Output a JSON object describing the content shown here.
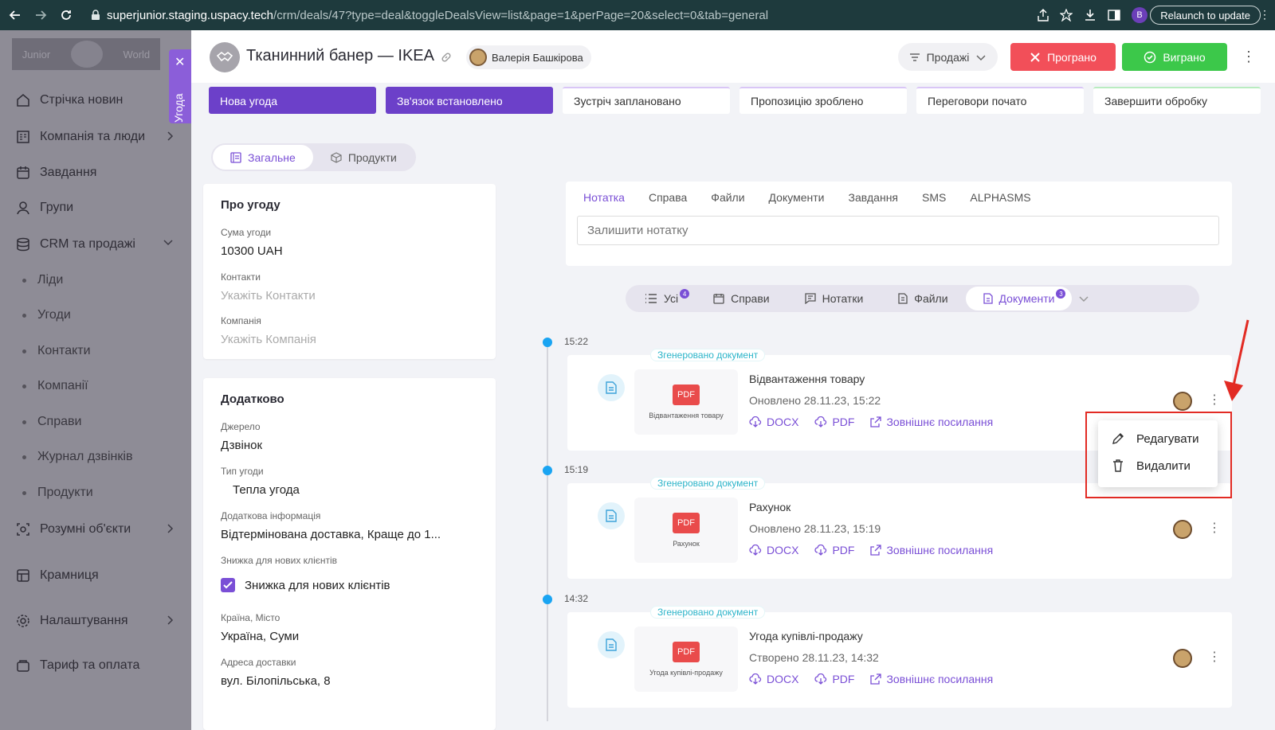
{
  "browser": {
    "url_host": "superjunior.staging.uspacy.tech",
    "url_path": "/crm/deals/47?type=deal&toggleDealsView=list&page=1&perPage=20&select=0&tab=general",
    "profile_letter": "B",
    "relaunch_label": "Relaunch to update"
  },
  "sidebar": {
    "logo_left": "Junior",
    "logo_right": "World",
    "items": [
      {
        "label": "Стрічка новин",
        "icon": "home-icon"
      },
      {
        "label": "Компанія та люди",
        "icon": "building-icon"
      },
      {
        "label": "Завдання",
        "icon": "calendar-icon"
      },
      {
        "label": "Групи",
        "icon": "users-icon"
      },
      {
        "label": "CRM та продажі",
        "icon": "crm-icon"
      },
      {
        "label": "Розумні об'єкти",
        "icon": "smart-objects-icon"
      },
      {
        "label": "Крамниця",
        "icon": "store-icon"
      },
      {
        "label": "Налаштування",
        "icon": "gear-icon"
      },
      {
        "label": "Тариф та оплата",
        "icon": "wallet-icon"
      }
    ],
    "crm_sub": [
      "Ліди",
      "Угоди",
      "Контакти",
      "Компанії",
      "Справи",
      "Журнал дзвінків",
      "Продукти"
    ],
    "vertical_tab": "Угода"
  },
  "header": {
    "title": "Тканинний банер — IKEA",
    "owner": "Валерія Башкірова",
    "pipeline": "Продажі",
    "lost_label": "Програно",
    "won_label": "Виграно"
  },
  "stages": [
    "Нова угода",
    "Зв'язок встановлено",
    "Зустріч заплановано",
    "Пропозицію зроблено",
    "Переговори почато",
    "Завершити обробку"
  ],
  "main_tabs": [
    "Загальне",
    "Продукти"
  ],
  "about": {
    "title": "Про угоду",
    "sum_label": "Сума угоди",
    "sum_value": "10300 UAH",
    "contacts_label": "Контакти",
    "contacts_placeholder": "Укажіть Контакти",
    "company_label": "Компанія",
    "company_placeholder": "Укажіть Компанія"
  },
  "extra": {
    "title": "Додатково",
    "source_label": "Джерело",
    "source_value": "Дзвінок",
    "type_label": "Тип угоди",
    "type_value": "Тепла угода",
    "info_label": "Додаткова інформація",
    "info_value": "Відтермінована доставка, Краще до 1...",
    "discount_label": "Знижка для нових клієнтів",
    "discount_value": "Знижка для нових клієнтів",
    "country_label": "Країна, Місто",
    "country_value": "Україна, Суми",
    "address_label": "Адреса доставки",
    "address_value": "вул. Білопільська, 8"
  },
  "activity": {
    "tabs": [
      "Нотатка",
      "Справа",
      "Файли",
      "Документи",
      "Завдання",
      "SMS",
      "ALPHASMS"
    ],
    "note_placeholder": "Залишити нотатку"
  },
  "filters": [
    {
      "label": "Усі",
      "badge": "4"
    },
    {
      "label": "Справи",
      "badge": ""
    },
    {
      "label": "Нотатки",
      "badge": ""
    },
    {
      "label": "Файли",
      "badge": ""
    },
    {
      "label": "Документи",
      "badge": "3"
    }
  ],
  "timeline": [
    {
      "time": "15:22",
      "tag": "Згенеровано документ",
      "pdf": "PDF",
      "thumb": "Відвантаження товару",
      "title": "Відвантаження товару",
      "sub": "Оновлено 28.11.23, 15:22",
      "docx": "DOCX",
      "pdf_link": "PDF",
      "ext": "Зовнішнє посилання"
    },
    {
      "time": "15:19",
      "tag": "Згенеровано документ",
      "pdf": "PDF",
      "thumb": "Рахунок",
      "title": "Рахунок",
      "sub": "Оновлено 28.11.23, 15:19",
      "docx": "DOCX",
      "pdf_link": "PDF",
      "ext": "Зовнішнє посилання"
    },
    {
      "time": "14:32",
      "tag": "Згенеровано документ",
      "pdf": "PDF",
      "thumb": "Угода купівлі-продажу",
      "title": "Угода купівлі-продажу",
      "sub": "Створено 28.11.23, 14:32",
      "docx": "DOCX",
      "pdf_link": "PDF",
      "ext": "Зовнішнє посилання"
    }
  ],
  "context_menu": {
    "edit": "Редагувати",
    "delete": "Видалити"
  },
  "colors": {
    "accent": "#7a4fd6",
    "lost": "#f24f59",
    "won": "#3cc84a",
    "timeline": "#1aa4f2",
    "highlight": "#e22b24"
  }
}
